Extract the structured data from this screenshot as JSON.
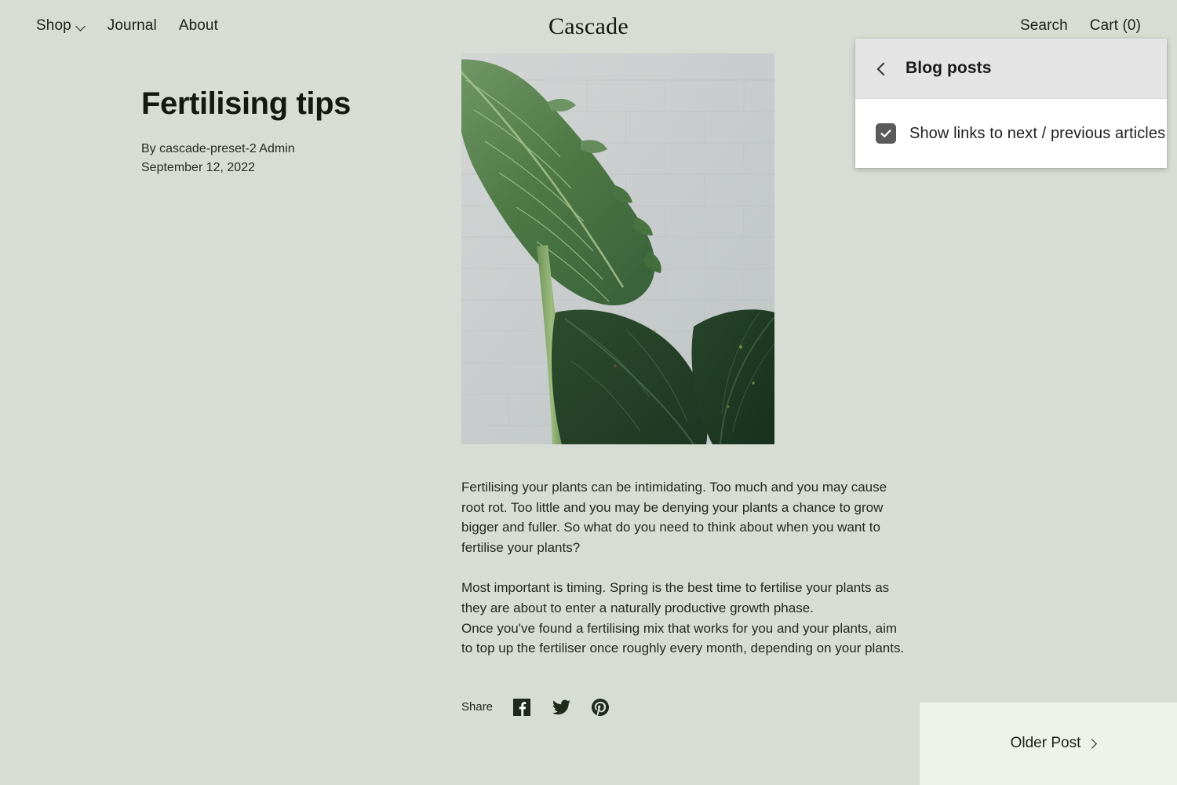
{
  "page": {
    "background_color": "#d7ddd4",
    "text_color": "#1c1f1b"
  },
  "header": {
    "brand": "Cascade",
    "nav_left": [
      {
        "label": "Shop",
        "icon": "chevron-down-icon",
        "has_dropdown": true
      },
      {
        "label": "Journal",
        "has_dropdown": false
      },
      {
        "label": "About",
        "has_dropdown": false
      }
    ],
    "nav_right": [
      {
        "label": "Search"
      },
      {
        "label": "Cart (0)"
      }
    ]
  },
  "article": {
    "title": "Fertilising tips",
    "author_line": "By cascade-preset-2 Admin",
    "date": "September 12, 2022",
    "hero_image_alt": "Large green alocasia leaf against a white painted brick wall",
    "paragraphs": [
      "Fertilising your plants can be intimidating. Too much and you may cause root rot. Too little and you may be denying your plants a chance to grow bigger and fuller. So what do you need to think about when you want to fertilise your plants?",
      "Most important is timing. Spring is the best time to fertilise your plants as they are about to enter a naturally productive growth phase.",
      "Once you've found a fertilising mix that works for you and your plants, aim to top up the fertiliser once roughly every month, depending on your plants."
    ]
  },
  "share": {
    "label": "Share",
    "icons": [
      {
        "name": "facebook-icon"
      },
      {
        "name": "twitter-icon"
      },
      {
        "name": "pinterest-icon"
      }
    ]
  },
  "pagination": {
    "older_post_label": "Older Post",
    "older_post_icon": "chevron-right-icon",
    "panel_color": "#edf3e8"
  },
  "settings_panel": {
    "back_icon": "chevron-left-icon",
    "title": "Blog posts",
    "header_color": "#e4e4e4",
    "checkbox": {
      "label": "Show links to next / previous articles",
      "checked": true,
      "color": "#5b5b5b"
    }
  }
}
